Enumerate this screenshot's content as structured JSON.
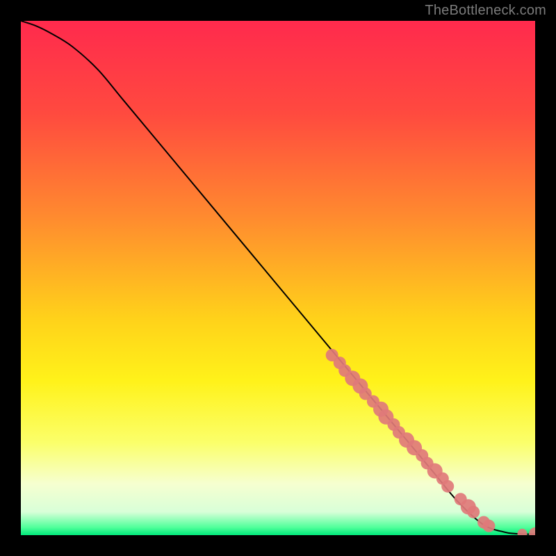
{
  "attribution": "TheBottleneck.com",
  "chart_data": {
    "type": "line",
    "title": "",
    "xlabel": "",
    "ylabel": "",
    "xlim": [
      0,
      100
    ],
    "ylim": [
      0,
      100
    ],
    "grid": false,
    "legend": false,
    "series": [
      {
        "name": "curve",
        "kind": "line",
        "color": "#000000",
        "x": [
          0,
          3,
          6,
          10,
          15,
          20,
          30,
          40,
          50,
          60,
          70,
          80,
          85,
          90,
          94,
          96,
          98,
          100
        ],
        "y": [
          100,
          99,
          97.5,
          95,
          90.5,
          84.5,
          72.5,
          60.5,
          48.5,
          36.5,
          24.5,
          12.5,
          6.5,
          2.0,
          0.6,
          0.3,
          0.2,
          0.2
        ]
      },
      {
        "name": "points",
        "kind": "scatter",
        "color": "#e07a7a",
        "x": [
          60.5,
          62.0,
          63.0,
          64.5,
          66.0,
          67.0,
          68.5,
          70.0,
          71.0,
          72.5,
          73.5,
          75.0,
          76.5,
          78.0,
          79.0,
          80.5,
          82.0,
          83.0,
          85.5,
          87.0,
          88.0,
          90.0,
          91.0,
          97.5,
          100.0
        ],
        "y": [
          35.0,
          33.5,
          32.0,
          30.5,
          29.0,
          27.5,
          26.0,
          24.5,
          23.0,
          21.5,
          20.0,
          18.5,
          17.0,
          15.5,
          14.0,
          12.5,
          11.0,
          9.5,
          7.0,
          5.5,
          4.5,
          2.5,
          1.8,
          0.3,
          0.3
        ],
        "sizes": [
          9,
          9,
          9,
          11,
          11,
          9,
          9,
          11,
          11,
          9,
          9,
          11,
          11,
          9,
          9,
          11,
          9,
          9,
          9,
          11,
          9,
          9,
          9,
          7,
          9
        ]
      }
    ],
    "background_gradient": {
      "stops": [
        {
          "offset": 0.0,
          "color": "#ff2a4d"
        },
        {
          "offset": 0.18,
          "color": "#ff4a3f"
        },
        {
          "offset": 0.38,
          "color": "#ff8a2f"
        },
        {
          "offset": 0.58,
          "color": "#ffd21a"
        },
        {
          "offset": 0.7,
          "color": "#fff21a"
        },
        {
          "offset": 0.82,
          "color": "#fbff6a"
        },
        {
          "offset": 0.9,
          "color": "#f6ffd0"
        },
        {
          "offset": 0.955,
          "color": "#d8ffd8"
        },
        {
          "offset": 0.985,
          "color": "#4fff9a"
        },
        {
          "offset": 1.0,
          "color": "#00e87a"
        }
      ]
    }
  }
}
